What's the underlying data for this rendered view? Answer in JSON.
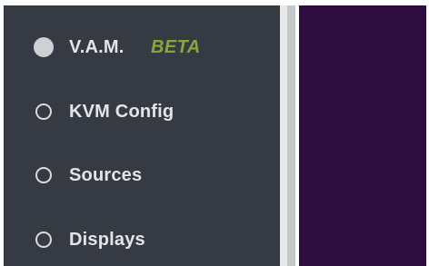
{
  "sidebar": {
    "items": [
      {
        "label": "V.A.M.",
        "badge": "BETA",
        "selected": true
      },
      {
        "label": "KVM Config",
        "selected": false
      },
      {
        "label": "Sources",
        "selected": false
      },
      {
        "label": "Displays",
        "selected": false
      }
    ]
  },
  "colors": {
    "sidebar_bg": "#363a43",
    "content_bg": "#2e0e40",
    "badge": "#8aa63a",
    "label": "#e4e5e8"
  },
  "icons": {
    "selected": "radio-selected-icon",
    "unselected": "radio-unselected-icon"
  }
}
